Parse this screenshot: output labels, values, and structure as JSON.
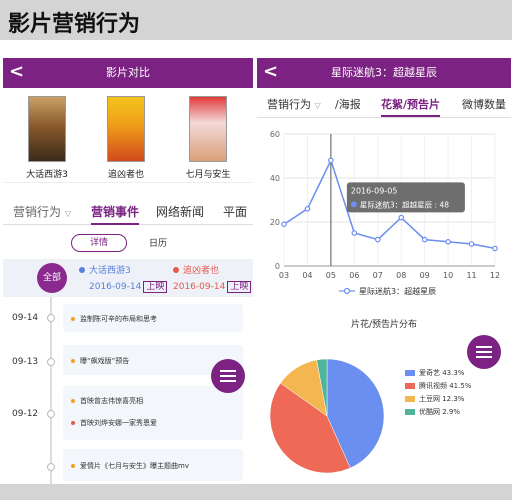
{
  "slide_title": "影片营销行为",
  "colors": {
    "brand": "#7b2282",
    "series_a": "#5a7fd8",
    "series_b": "#e4594f"
  },
  "left_screen": {
    "header_title": "影片对比",
    "back_icon": "chevron-left-icon",
    "movies": [
      {
        "name": "大话西游3"
      },
      {
        "name": "追凶者也"
      },
      {
        "name": "七月与安生"
      }
    ],
    "tabs": [
      "营销行为",
      "营销事件",
      "网络新闻",
      "平面"
    ],
    "subtabs": {
      "details": "详情",
      "calendar": "日历"
    },
    "all_label": "全部",
    "movie_a": {
      "name": "大话西游3",
      "date": "2016-09-14",
      "tag": "上映"
    },
    "movie_b": {
      "name": "追凶者也",
      "date": "2016-09-14",
      "tag": "上映"
    },
    "timeline": [
      {
        "date": "09-14",
        "events": [
          {
            "text": "监制陈可辛的布局和思考",
            "movie": "a"
          }
        ]
      },
      {
        "date": "09-13",
        "events": [
          {
            "text": "曝“飙戏版”预告",
            "movie": "a"
          }
        ]
      },
      {
        "date": "09-12",
        "events": [
          {
            "text": "首映曾志伟惊喜亮相",
            "movie": "a"
          },
          {
            "text": "首映刘烨安娜一家秀恩爱",
            "movie": "b"
          }
        ]
      },
      {
        "date": "",
        "events": [
          {
            "text": "爱情片《七月与安生》曝主题曲mv",
            "movie": "a"
          }
        ]
      }
    ]
  },
  "right_screen": {
    "header_title": "星际迷航3：超越星辰",
    "back_icon": "chevron-left-icon",
    "tabs": [
      "营销行为",
      "/海报",
      "花絮/预告片",
      "微博数量"
    ],
    "tooltip": {
      "date": "2016-09-05",
      "label": "星际迷航3：超越星辰 : 48"
    },
    "line_legend": "星际迷航3：超越星辰",
    "pie_title": "片花/预告片分布",
    "pie_legend": [
      "爱奇艺 43.3%",
      "腾讯视频 41.5%",
      "土豆网 12.3%",
      "优酷网 2.9%"
    ]
  },
  "chart_data": [
    {
      "type": "line",
      "x": [
        "03",
        "04",
        "05",
        "06",
        "07",
        "08",
        "09",
        "10",
        "11",
        "12"
      ],
      "series": [
        {
          "name": "星际迷航3：超越星辰",
          "values": [
            19,
            26,
            48,
            15,
            12,
            22,
            12,
            11,
            10,
            8
          ]
        }
      ],
      "yticks": [
        "0",
        "20",
        "40",
        "60"
      ],
      "ylim": [
        0,
        60
      ],
      "grid": true,
      "legend": "bottom-center"
    },
    {
      "type": "pie",
      "title": "片花/预告片分布",
      "categories": [
        "爱奇艺",
        "腾讯视频",
        "土豆网",
        "优酷网"
      ],
      "values": [
        43.3,
        41.5,
        12.3,
        2.9
      ],
      "colors": [
        "#6b8ff0",
        "#ee6a56",
        "#f4b650",
        "#4fb59a"
      ],
      "legend": "right"
    }
  ]
}
